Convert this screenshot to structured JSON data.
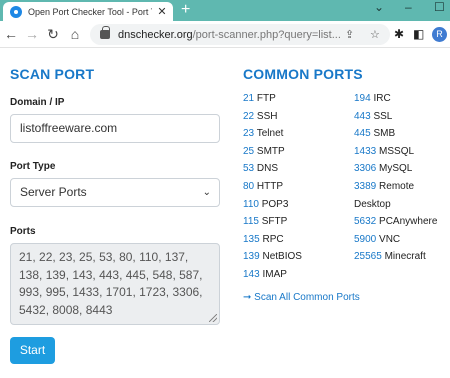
{
  "browser": {
    "tab_title": "Open Port Checker Tool - Port Te",
    "tab_close": "✕",
    "new_tab": "+",
    "url_host": "dnschecker.org",
    "url_path": "/port-scanner.php?query=list...",
    "profile_initial": "R"
  },
  "scan_port": {
    "heading": "SCAN PORT",
    "domain_label": "Domain / IP",
    "domain_value": "listoffreeware.com",
    "port_type_label": "Port Type",
    "port_type_value": "Server Ports",
    "ports_label": "Ports",
    "ports_value": "21, 22, 23, 25, 53, 80, 110, 137, 138, 139, 143, 443, 445, 548, 587, 993, 995, 1433, 1701, 1723, 3306, 5432, 8008, 8443",
    "start_label": "Start"
  },
  "common_ports": {
    "heading": "COMMON PORTS",
    "left": [
      {
        "port": "21",
        "name": "FTP"
      },
      {
        "port": "22",
        "name": "SSH"
      },
      {
        "port": "23",
        "name": "Telnet"
      },
      {
        "port": "25",
        "name": "SMTP"
      },
      {
        "port": "53",
        "name": "DNS"
      },
      {
        "port": "80",
        "name": "HTTP"
      },
      {
        "port": "110",
        "name": "POP3"
      },
      {
        "port": "115",
        "name": "SFTP"
      },
      {
        "port": "135",
        "name": "RPC"
      },
      {
        "port": "139",
        "name": "NetBIOS"
      },
      {
        "port": "143",
        "name": "IMAP"
      }
    ],
    "right": [
      {
        "port": "194",
        "name": "IRC"
      },
      {
        "port": "443",
        "name": "SSL"
      },
      {
        "port": "445",
        "name": "SMB"
      },
      {
        "port": "1433",
        "name": "MSSQL"
      },
      {
        "port": "3306",
        "name": "MySQL"
      },
      {
        "port": "3389",
        "name": "Remote"
      },
      {
        "port": "",
        "name": "Desktop"
      },
      {
        "port": "5632",
        "name": "PCAnywhere"
      },
      {
        "port": "5900",
        "name": "VNC"
      },
      {
        "port": "25565",
        "name": "Minecraft"
      }
    ],
    "scan_all_label": "➞ Scan All Common Ports"
  },
  "colors": {
    "tabstrip": "#5fb8b0",
    "accent": "#1878c8",
    "button": "#1e9de0"
  }
}
